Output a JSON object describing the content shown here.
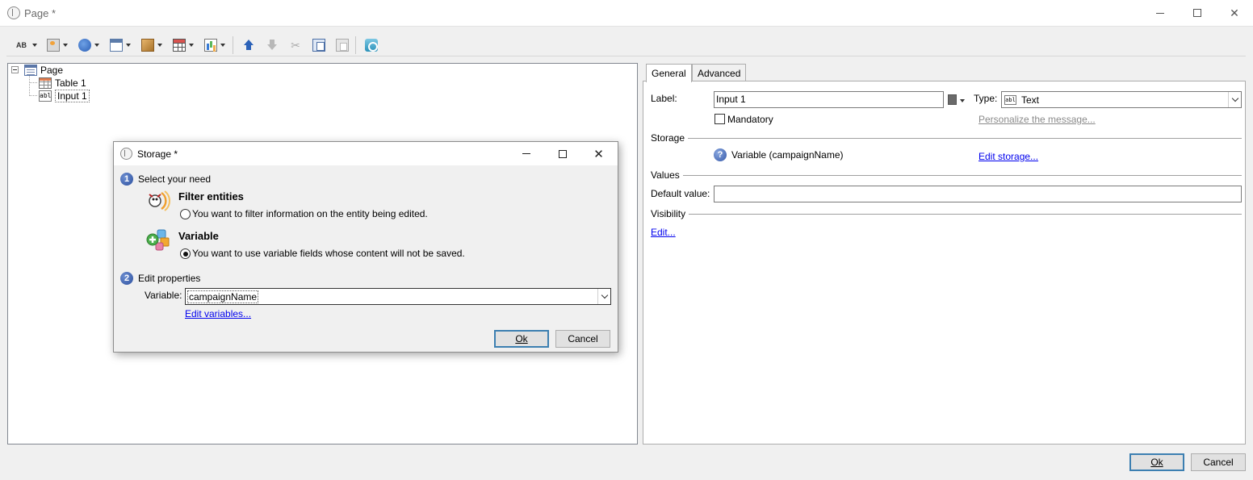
{
  "window": {
    "title": "Page *"
  },
  "toolbar": {
    "icons": [
      "text-field-icon",
      "image-icon",
      "globe-icon",
      "window-icon",
      "box-icon",
      "table-icon",
      "chart-icon",
      "move-up-icon",
      "move-down-icon",
      "cut-icon",
      "copy-icon",
      "paste-icon",
      "recycle-icon"
    ],
    "text_icon_label": "AB"
  },
  "tree": {
    "root": "Page",
    "children": [
      "Table 1",
      "Input 1"
    ]
  },
  "tabs": [
    {
      "label": "General",
      "active": true
    },
    {
      "label": "Advanced",
      "active": false
    }
  ],
  "general": {
    "label_caption": "Label:",
    "label_value": "Input 1",
    "type_caption": "Type:",
    "type_value": "Text",
    "type_icon_text": "abl",
    "mandatory_label": "Mandatory",
    "mandatory_checked": false,
    "personalize_link": "Personalize the message...",
    "storage_section": "Storage",
    "storage_value": "Variable (campaignName)",
    "edit_storage_link": "Edit storage...",
    "values_section": "Values",
    "default_value_caption": "Default value:",
    "default_value": "",
    "visibility_section": "Visibility",
    "visibility_edit_link": "Edit..."
  },
  "footer": {
    "ok_label": "Ok",
    "cancel_label": "Cancel"
  },
  "dialog": {
    "title": "Storage *",
    "step1_number": "1",
    "step1_label": "Select your need",
    "option_filter_title": "Filter entities",
    "option_filter_desc": "You want to filter information on the entity being edited.",
    "option_filter_selected": false,
    "option_variable_title": "Variable",
    "option_variable_desc": "You want to use variable fields whose content will not be saved.",
    "option_variable_selected": true,
    "step2_number": "2",
    "step2_label": "Edit properties",
    "variable_caption": "Variable:",
    "variable_value": "campaignName",
    "edit_variables_link": "Edit variables...",
    "ok_label": "Ok",
    "cancel_label": "Cancel"
  },
  "colors": {
    "link": "#0000ee",
    "default_button_border": "#3c7fb1",
    "step_badge": "#2b4f9e"
  }
}
